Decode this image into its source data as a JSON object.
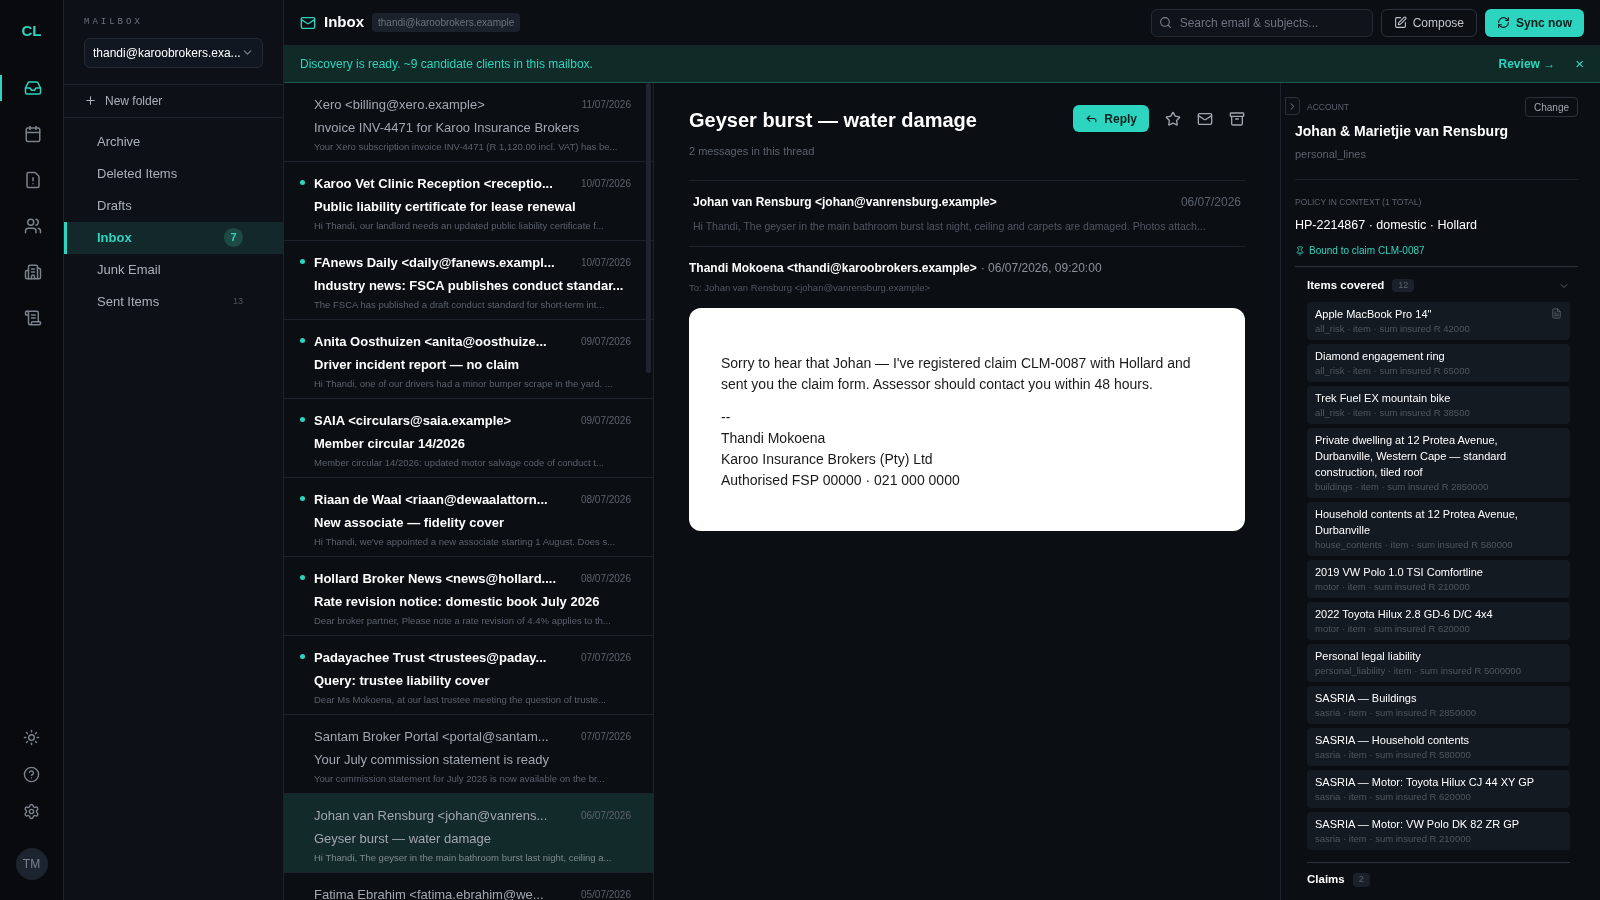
{
  "app": {
    "logo": "CL",
    "avatar": "TM",
    "rail": [
      {
        "selected": true
      },
      {
        "selected": false
      },
      {
        "selected": false
      },
      {
        "selected": false
      },
      {
        "selected": false
      },
      {
        "selected": false
      }
    ]
  },
  "mailbox": {
    "label": "MAILBOX",
    "account": "thandi@karoobrokers.exa...",
    "new_folder": "New folder",
    "folders": [
      {
        "name": "Archive",
        "selected": false
      },
      {
        "name": "Deleted Items",
        "selected": false
      },
      {
        "name": "Drafts",
        "selected": false
      },
      {
        "name": "Inbox",
        "selected": true,
        "count": "7"
      },
      {
        "name": "Junk Email",
        "selected": false
      },
      {
        "name": "Sent Items",
        "selected": false,
        "count": "13"
      }
    ]
  },
  "header": {
    "title": "Inbox",
    "address": "thandi@karoobrokers.example",
    "search_placeholder": "Search email & subjects...",
    "compose": "Compose",
    "sync": "Sync now"
  },
  "banner": {
    "text": "Discovery is ready. ~9 candidate clients in this mailbox.",
    "action": "Review →",
    "close": "×"
  },
  "messages": [
    {
      "from": "Xero <billing@xero.example>",
      "date": "11/07/2026",
      "subject": "Invoice INV-4471 for Karoo Insurance Brokers",
      "preview": "Your Xero subscription invoice INV-4471 (R 1,120.00 incl. VAT) has be...",
      "unread": false,
      "selected": false
    },
    {
      "from": "Karoo Vet Clinic Reception <receptio...",
      "date": "10/07/2026",
      "subject": "Public liability certificate for lease renewal",
      "preview": "Hi Thandi, our landlord needs an updated public liability certificate f...",
      "unread": true,
      "selected": false
    },
    {
      "from": "FAnews Daily <daily@fanews.exampl...",
      "date": "10/07/2026",
      "subject": "Industry news: FSCA publishes conduct standar...",
      "preview": "The FSCA has published a draft conduct standard for short-term int...",
      "unread": true,
      "selected": false
    },
    {
      "from": "Anita Oosthuizen <anita@oosthuize...",
      "date": "09/07/2026",
      "subject": "Driver incident report — no claim",
      "preview": "Hi Thandi, one of our drivers had a minor bumper scrape in the yard. ...",
      "unread": true,
      "selected": false
    },
    {
      "from": "SAIA <circulars@saia.example>",
      "date": "09/07/2026",
      "subject": "Member circular 14/2026",
      "preview": "Member circular 14/2026: updated motor salvage code of conduct t...",
      "unread": true,
      "selected": false
    },
    {
      "from": "Riaan de Waal <riaan@dewaalattorn...",
      "date": "08/07/2026",
      "subject": "New associate — fidelity cover",
      "preview": "Hi Thandi, we've appointed a new associate starting 1 August. Does s...",
      "unread": true,
      "selected": false
    },
    {
      "from": "Hollard Broker News <news@hollard....",
      "date": "08/07/2026",
      "subject": "Rate revision notice: domestic book July 2026",
      "preview": "Dear broker partner, Please note a rate revision of 4.4% applies to th...",
      "unread": true,
      "selected": false
    },
    {
      "from": "Padayachee Trust <trustees@paday...",
      "date": "07/07/2026",
      "subject": "Query: trustee liability cover",
      "preview": "Dear Ms Mokoena, at our last trustee meeting the question of truste...",
      "unread": true,
      "selected": false
    },
    {
      "from": "Santam Broker Portal <portal@santam...",
      "date": "07/07/2026",
      "subject": "Your July commission statement is ready",
      "preview": "Your commission statement for July 2026 is now available on the br...",
      "unread": false,
      "selected": false
    },
    {
      "from": "Johan van Rensburg <johan@vanrens...",
      "date": "06/07/2026",
      "subject": "Geyser burst — water damage",
      "preview": "Hi Thandi, The geyser in the main bathroom burst last night, ceiling a...",
      "unread": false,
      "selected": true
    },
    {
      "from": "Fatima Ebrahim <fatima.ebrahim@we...",
      "date": "05/07/2026",
      "unread": false,
      "selected": false
    }
  ],
  "thread": {
    "subject": "Geyser burst — water damage",
    "count": "2 messages in this thread",
    "reply": "Reply",
    "collapsed": {
      "from": "Johan van Rensburg <johan@vanrensburg.example>",
      "date": "06/07/2026",
      "preview": "Hi Thandi, The geyser in the main bathroom burst last night, ceiling and carpets are damaged. Photos attach..."
    },
    "open": {
      "from": "Thandi Mokoena <thandi@karoobrokers.example>",
      "date": "· 06/07/2026, 09:20:00",
      "to": "To: Johan van Rensburg <johan@vanrensburg.example>",
      "body": "Sorry to hear that Johan — I've registered claim CLM-0087 with Hollard and sent you the claim form. Assessor should contact you within 48 hours.",
      "signature": [
        "--",
        "Thandi Mokoena",
        "Karoo Insurance Brokers (Pty) Ltd",
        "Authorised FSP 00000 · 021 000 0000"
      ]
    }
  },
  "context": {
    "label": "ACCOUNT",
    "change": "Change",
    "client": "Johan & Marietjie van Rensburg",
    "segment": "personal_lines",
    "policy_label": "POLICY IN CONTEXT (1 TOTAL)",
    "policy": "HP-2214867 · domestic · Hollard",
    "bound": "Bound to claim CLM-0087",
    "items_title": "Items covered",
    "items_count": "12",
    "items_expanded": true,
    "items": [
      {
        "name": "Apple MacBook Pro 14\"",
        "meta": "all_risk · item · sum insured R 42000",
        "document": true
      },
      {
        "name": "Diamond engagement ring",
        "meta": "all_risk · item · sum insured R 65000",
        "document": false
      },
      {
        "name": "Trek Fuel EX mountain bike",
        "meta": "all_risk · item · sum insured R 38500",
        "document": false
      },
      {
        "name": "Private dwelling at 12 Protea Avenue, Durbanville, Western Cape — standard construction, tiled roof",
        "meta": "buildings · item · sum insured R 2850000",
        "document": false
      },
      {
        "name": "Household contents at 12 Protea Avenue, Durbanville",
        "meta": "house_contents · item · sum insured R 580000",
        "document": false
      },
      {
        "name": "2019 VW Polo 1.0 TSI Comfortline",
        "meta": "motor · item · sum insured R 210000",
        "document": false
      },
      {
        "name": "2022 Toyota Hilux 2.8 GD-6 D/C 4x4",
        "meta": "motor · item · sum insured R 620000",
        "document": false
      },
      {
        "name": "Personal legal liability",
        "meta": "personal_liability · item · sum insured R 5000000",
        "document": false
      },
      {
        "name": "SASRIA — Buildings",
        "meta": "sasria · item · sum insured R 2850000",
        "document": false
      },
      {
        "name": "SASRIA — Household contents",
        "meta": "sasria · item · sum insured R 580000",
        "document": false
      },
      {
        "name": "SASRIA — Motor: Toyota Hilux CJ 44 XY GP",
        "meta": "sasria · item · sum insured R 620000",
        "document": false
      },
      {
        "name": "SASRIA — Motor: VW Polo DK 82 ZR GP",
        "meta": "sasria · item · sum insured R 210000",
        "document": false
      }
    ],
    "claims_title": "Claims",
    "claims_count": "2"
  }
}
